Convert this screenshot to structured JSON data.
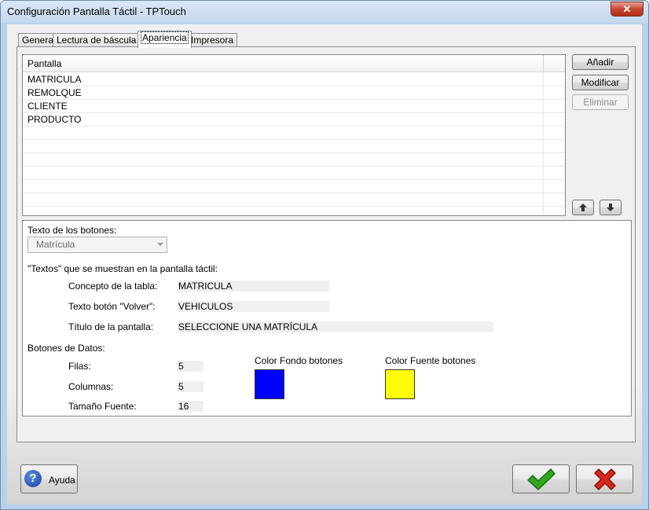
{
  "window": {
    "title": "Configuración Pantalla Táctil - TPTouch",
    "close_glyph": "✕"
  },
  "tabs": [
    {
      "label": "General"
    },
    {
      "label": "Lectura de báscula"
    },
    {
      "label": "Apariencia"
    },
    {
      "label": "Impresora"
    }
  ],
  "active_tab": "Apariencia",
  "screens_grid": {
    "header": "Pantalla",
    "rows": [
      "MATRICULA",
      "REMOLQUE",
      "CLIENTE",
      "PRODUCTO"
    ]
  },
  "side_buttons": {
    "add": "Añadir",
    "modify": "Modificar",
    "delete": "Eliminar",
    "up_icon": "arrow-up-icon",
    "down_icon": "arrow-down-icon"
  },
  "button_text": {
    "label": "Texto de los botones:",
    "selected": "Matrícula"
  },
  "texts_section": {
    "label": "\"Textos\" que se muestran en la pantalla táctil:",
    "table_concept_label": "Concepto de la tabla:",
    "table_concept_value": "MATRICULA",
    "back_button_label": "Texto botón \"Volver\":",
    "back_button_value": "VEHICULOS",
    "screen_title_label": "Título de la pantalla:",
    "screen_title_value": "SELECCIONE UNA MATRÍCULA"
  },
  "data_buttons": {
    "label": "Botones de Datos:",
    "rows_label": "Filas:",
    "rows_value": "5",
    "columns_label": "Columnas:",
    "columns_value": "5",
    "font_size_label": "Tamaño Fuente:",
    "font_size_value": "16",
    "bg_color_label": "Color Fondo botones",
    "bg_color": "#0000ff",
    "font_color_label": "Color Fuente botones",
    "font_color": "#ffff00"
  },
  "footer": {
    "help_label": "Ayuda",
    "help_icon": "help-icon",
    "ok_icon": "checkmark-icon",
    "cancel_icon": "cross-icon",
    "ok_color": "#2fa81c",
    "cancel_color": "#d8261a"
  }
}
